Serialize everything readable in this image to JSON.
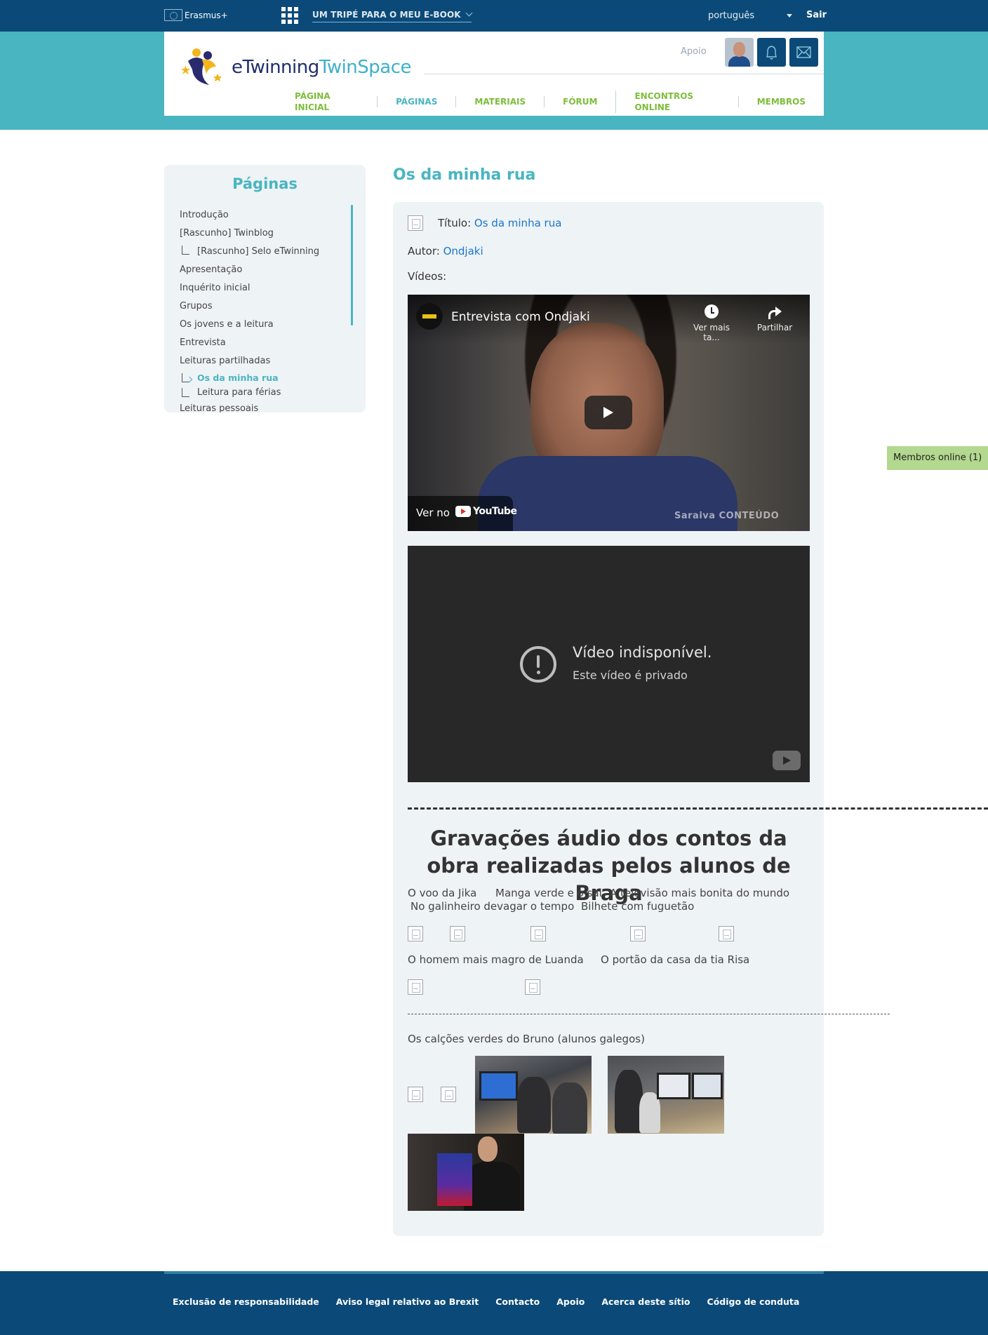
{
  "topbar": {
    "erasmus_label": "Erasmus+",
    "project_title": "UM TRIPÉ PARA O MEU E-BOOK",
    "language": "português",
    "logout": "Sair"
  },
  "header": {
    "logo_main": "eTwinning",
    "logo_sub": "TwinSpace",
    "support": "Apoio",
    "nav": [
      {
        "label": "PÁGINA INICIAL",
        "active": false
      },
      {
        "label": "PÁGINAS",
        "active": true
      },
      {
        "label": "MATERIAIS",
        "active": false
      },
      {
        "label": "FÓRUM",
        "active": false
      },
      {
        "label": "ENCONTROS ONLINE",
        "active": false
      },
      {
        "label": "MEMBROS",
        "active": false
      }
    ]
  },
  "sidebar": {
    "title": "Páginas",
    "items": [
      "Introdução",
      "[Rascunho] Twinblog",
      "[Rascunho] Selo eTwinning",
      "Apresentação",
      "Inquérito inicial",
      "Grupos",
      "Os jovens e a leitura",
      "Entrevista",
      "Leituras partilhadas",
      "Os da minha rua",
      "Leitura para férias",
      "Leituras pessoais"
    ]
  },
  "main": {
    "page_title": "Os da minha rua",
    "title_label": "Título:",
    "title_value": "Os da minha rua",
    "author_label": "Autor:",
    "author_value": "Ondjaki",
    "videos_label": "Vídeos:",
    "video1": {
      "title": "Entrevista com Ondjaki",
      "watch_later": "Ver mais ta...",
      "share": "Partilhar",
      "watch_on": "Ver no",
      "yt": "YouTube",
      "watermark": "Saraiva   CONTEÚDO"
    },
    "video2": {
      "title": "Vídeo indisponível.",
      "subtitle": "Este vídeo é privado"
    },
    "audio_heading": "Gravações áudio dos contos da obra realizadas pelos alunos de Braga",
    "audio_row1": [
      "O voo da Jika",
      "Manga verde e o sal",
      "A televisão mais bonita do mundo"
    ],
    "audio_row2": [
      "No galinheiro devagar o tempo",
      "Bilhete com fuguetão"
    ],
    "audio_row3": [
      "O homem mais magro de Luanda",
      "O portão da casa da tia Risa"
    ],
    "galician_label": "Os calções verdes do Bruno (alunos galegos)"
  },
  "members_online": "Membros online (1)",
  "footer": {
    "links": [
      "Exclusão de responsabilidade",
      "Aviso legal relativo ao Brexit",
      "Contacto",
      "Apoio",
      "Acerca deste sítio",
      "Código de conduta"
    ]
  }
}
